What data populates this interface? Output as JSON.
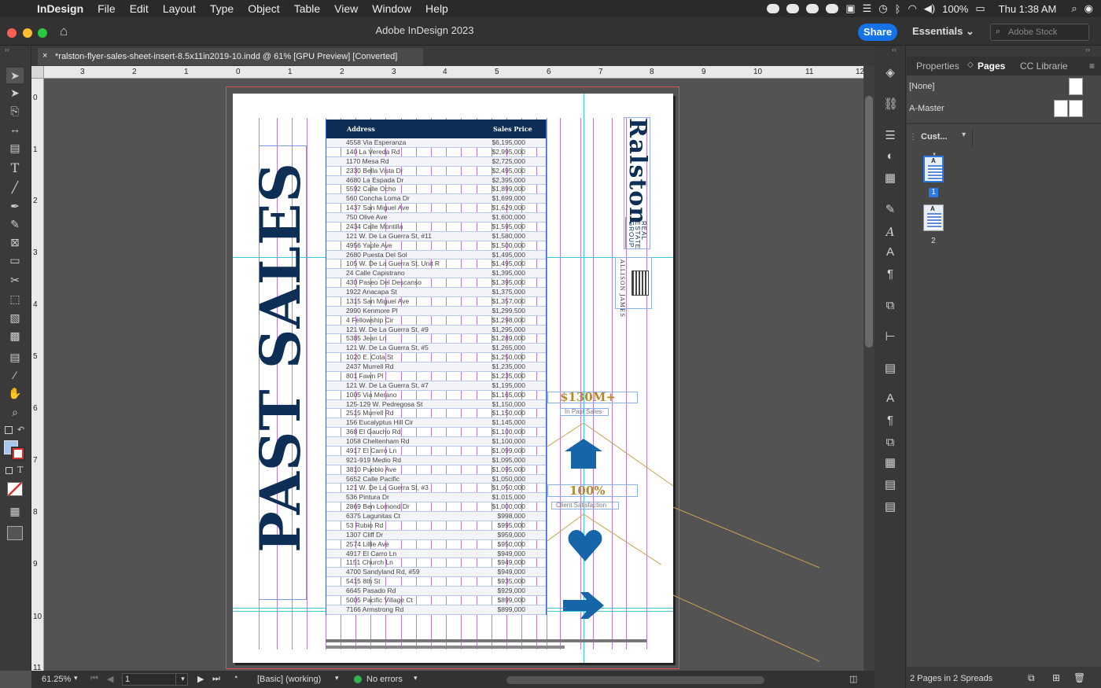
{
  "menubar": {
    "app_name": "InDesign",
    "items": [
      "File",
      "Edit",
      "Layout",
      "Type",
      "Object",
      "Table",
      "View",
      "Window",
      "Help"
    ],
    "battery": "100%",
    "clock": "Thu 1:38 AM"
  },
  "appbar": {
    "title": "Adobe InDesign 2023",
    "share_label": "Share",
    "workspace": "Essentials",
    "stock_placeholder": "Adobe Stock"
  },
  "document_tab": {
    "close": "×",
    "title": "*ralston-flyer-sales-sheet-insert-8.5x11in2019-10.indd @ 61% [GPU Preview] [Converted]"
  },
  "ruler": {
    "h_labels": [
      "3",
      "2",
      "1",
      "0",
      "1",
      "2",
      "3",
      "4",
      "5",
      "6",
      "7",
      "8",
      "9",
      "10",
      "11",
      "12"
    ],
    "v_labels": [
      "0",
      "1",
      "2",
      "3",
      "4",
      "5",
      "6",
      "7",
      "8",
      "9",
      "10",
      "11"
    ]
  },
  "flyer": {
    "title": "PAST SALES",
    "table_headers": {
      "address": "Address",
      "price": "Sales Price"
    },
    "sales": [
      [
        "4558 Via Esperanza",
        "$6,195,000"
      ],
      [
        "140 La Vereda Rd",
        "$2,995,000"
      ],
      [
        "1170 Mesa Rd",
        "$2,725,000"
      ],
      [
        "2330 Bella Vista Dr",
        "$2,495,000"
      ],
      [
        "4680 La Espada Dr",
        "$2,395,000"
      ],
      [
        "5592 Calle Ocho",
        "$1,899,000"
      ],
      [
        "560 Concha Loma Dr",
        "$1,699,000"
      ],
      [
        "1437 San Miguel Ave",
        "$1,629,000"
      ],
      [
        "750 Olive Ave",
        "$1,600,000"
      ],
      [
        "2434 Calle Montilla",
        "$1,595,000"
      ],
      [
        "121 W. De La Guerra St, #11",
        "$1,580,000"
      ],
      [
        "4956 Yaple Ave",
        "$1,500,000"
      ],
      [
        "2680 Puesta Del Sol",
        "$1,495,000"
      ],
      [
        "105 W. De La Guerra St, Unit R",
        "$1,495,000"
      ],
      [
        "24 Calle Capistrano",
        "$1,395,000"
      ],
      [
        "430 Paseo Del Descanso",
        "$1,395,000"
      ],
      [
        "1922 Anacapa St",
        "$1,375,000"
      ],
      [
        "1315 San Miguel Ave",
        "$1,357,000"
      ],
      [
        "2990 Kenmore Pl",
        "$1,299,500"
      ],
      [
        "4 Fellowship Cir",
        "$1,298,000"
      ],
      [
        "121 W. De La Guerra St, #9",
        "$1,295,000"
      ],
      [
        "5385 Jean Ln",
        "$1,289,000"
      ],
      [
        "121 W. De La Guerra St, #5",
        "$1,265,000"
      ],
      [
        "1020 E. Cota St",
        "$1,250,000"
      ],
      [
        "2437 Murrell Rd",
        "$1,235,000"
      ],
      [
        "801 Fawn Pl",
        "$1,235,000"
      ],
      [
        "121 W. De La Guerra St, #7",
        "$1,195,000"
      ],
      [
        "1005 Via Merano",
        "$1,165,000"
      ],
      [
        "125-129 W. Pedregosa St",
        "$1,150,000"
      ],
      [
        "2515 Murrell Rd",
        "$1,150,000"
      ],
      [
        "156 Eucalyptus Hill Cir",
        "$1,145,000"
      ],
      [
        "368 El Gaucho Rd",
        "$1,100,000"
      ],
      [
        "1058 Cheltenham Rd",
        "$1,100,000"
      ],
      [
        "4917 El Carro Ln",
        "$1,099,000"
      ],
      [
        "921-919 Medio Rd",
        "$1,095,000"
      ],
      [
        "3810 Pueblo Ave",
        "$1,095,000"
      ],
      [
        "5652 Calle Pacific",
        "$1,050,000"
      ],
      [
        "121 W. De La Guerra St, #3",
        "$1,050,000"
      ],
      [
        "536 Pintura Dr",
        "$1,015,000"
      ],
      [
        "2869 Ben Lomond Dr",
        "$1,000,000"
      ],
      [
        "6375 Lagunitas Ct",
        "$998,000"
      ],
      [
        "53 Rubio Rd",
        "$995,000"
      ],
      [
        "1307 Cliff Dr",
        "$959,000"
      ],
      [
        "2574 Lillie Ave",
        "$950,000"
      ],
      [
        "4917 El Carro Ln",
        "$949,000"
      ],
      [
        "1151 Church Ln",
        "$949,000"
      ],
      [
        "4700 Sandyland Rd, #59",
        "$949,000"
      ],
      [
        "5415 8th St",
        "$935,000"
      ],
      [
        "6645 Pasado Rd",
        "$929,000"
      ],
      [
        "5005 Pacific Village Ct",
        "$899,000"
      ],
      [
        "7166 Armstrong Rd",
        "$899,000"
      ]
    ],
    "brand_name": "Ralston",
    "brand_sub": "REAL ESTATE GROUP",
    "brand_partner": "ALLISON JAMES",
    "stat1_value": "$130M+",
    "stat1_label": "In Past Sales",
    "stat2_value": "100%",
    "stat2_label": "Client Satisfaction",
    "accent_navy": "#0d2f55",
    "accent_blue": "#1565a8",
    "accent_gold": "#b58a2e"
  },
  "panels": {
    "tabs": [
      "Properties",
      "Pages",
      "CC Librarie"
    ],
    "active_tab": "Pages",
    "masters": [
      "[None]",
      "A-Master"
    ],
    "size_dropdown": "Cust...",
    "page_numbers": [
      "1",
      "2"
    ],
    "master_letter": "A",
    "footer": "2 Pages in 2 Spreads"
  },
  "statusbar": {
    "zoom": "61.25%",
    "page": "1",
    "preflight_profile": "[Basic] (working)",
    "errors": "No errors"
  }
}
